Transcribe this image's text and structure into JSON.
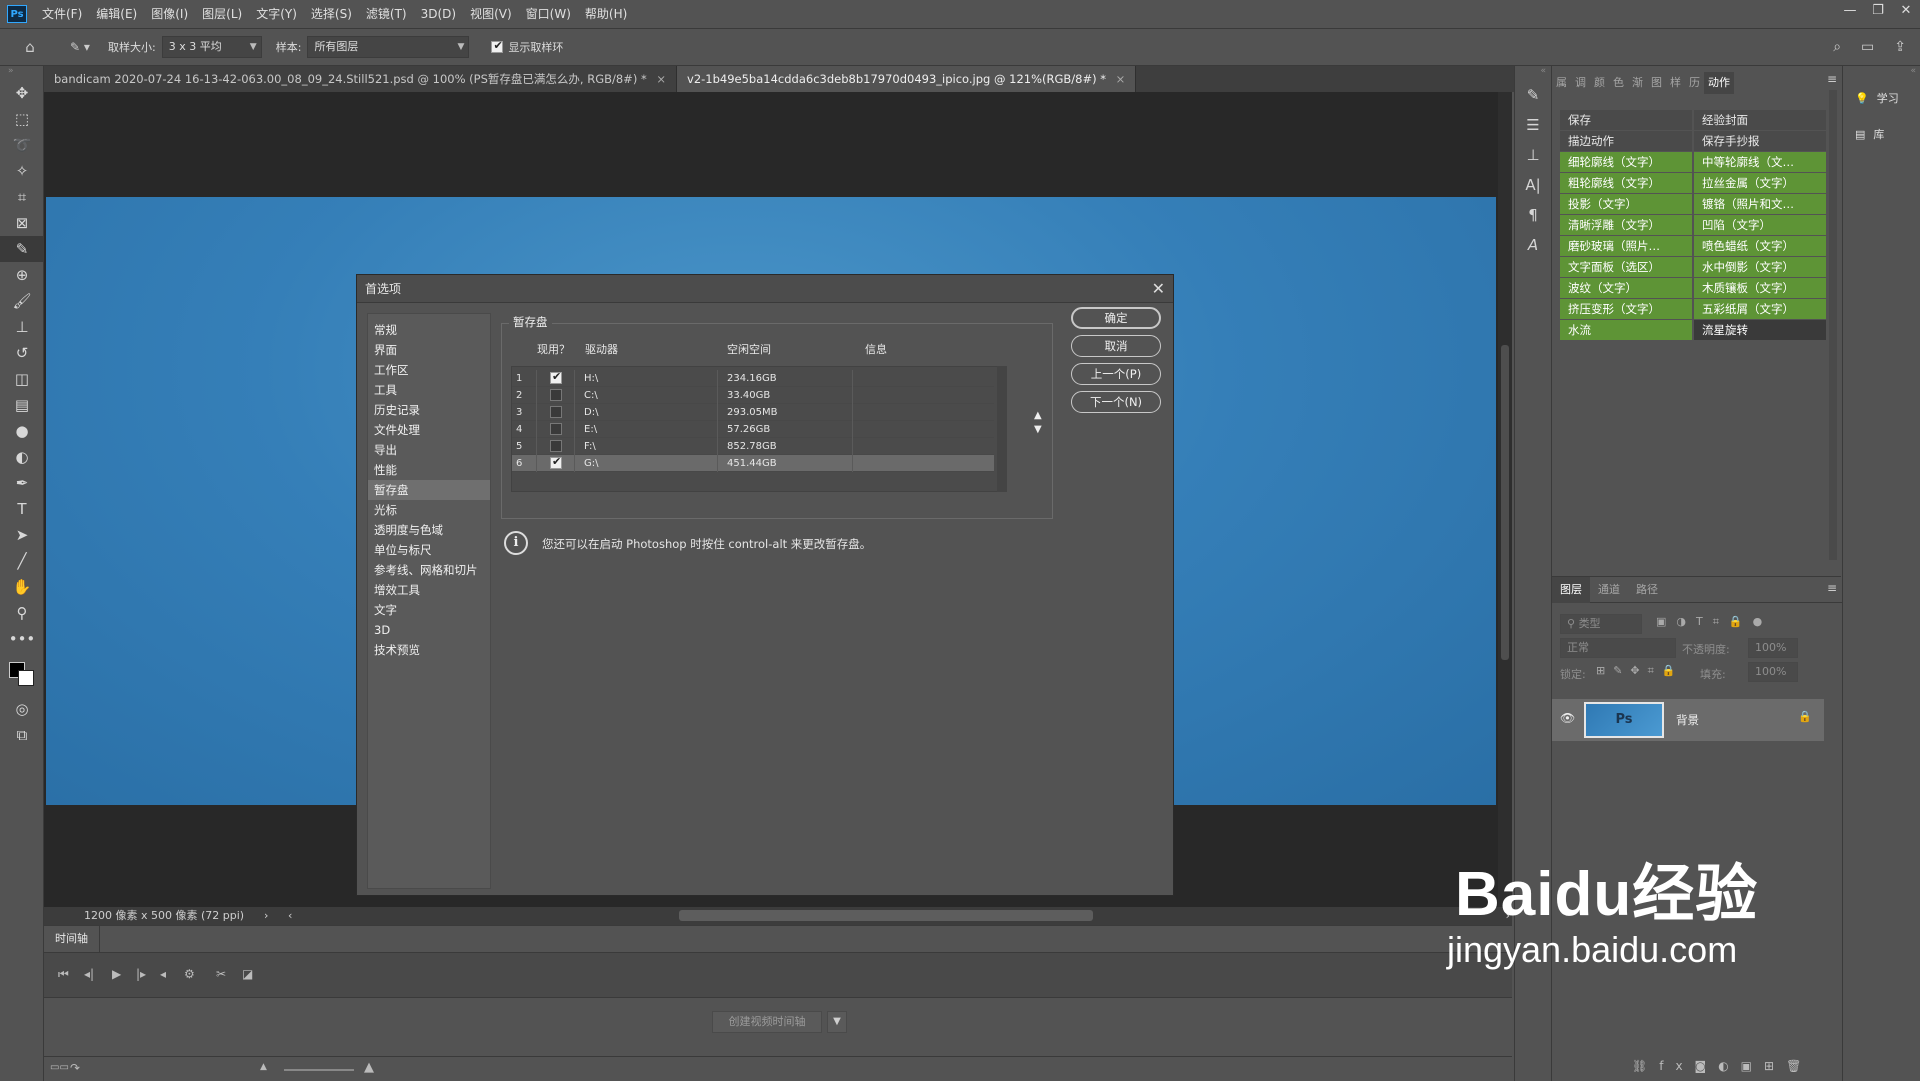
{
  "menubar": {
    "logo": "Ps",
    "items": [
      "文件(F)",
      "编辑(E)",
      "图像(I)",
      "图层(L)",
      "文字(Y)",
      "选择(S)",
      "滤镜(T)",
      "3D(D)",
      "视图(V)",
      "窗口(W)",
      "帮助(H)"
    ]
  },
  "optbar": {
    "sample_size_label": "取样大小:",
    "sample_size_value": "3 x 3 平均",
    "sample_label": "样本:",
    "sample_value": "所有图层",
    "show_ring_label": "显示取样环"
  },
  "tabs": [
    {
      "label": "bandicam 2020-07-24 16-13-42-063.00_08_09_24.Still521.psd @ 100% (PS暂存盘已满怎么办, RGB/8#) *",
      "active": false
    },
    {
      "label": "v2-1b49e5ba14cdda6c3deb8b17970d0493_ipico.jpg @ 121%(RGB/8#) *",
      "active": true
    }
  ],
  "status": {
    "doc_size": "1200 像素 x 500 像素 (72 ppi)"
  },
  "timeline": {
    "tab_label": "时间轴",
    "create_button": "创建视频时间轴"
  },
  "actions_panel": {
    "tabs": [
      "属",
      "调",
      "颜",
      "色",
      "渐",
      "图",
      "样",
      "历",
      "动作"
    ],
    "actions": [
      {
        "label": "保存",
        "style": "plain"
      },
      {
        "label": "经验封面",
        "style": "plain"
      },
      {
        "label": "描边动作",
        "style": "plain"
      },
      {
        "label": "保存手抄报",
        "style": "plain"
      },
      {
        "label": "细轮廓线（文字）",
        "style": "green"
      },
      {
        "label": "中等轮廓线（文…",
        "style": "green"
      },
      {
        "label": "粗轮廓线（文字）",
        "style": "green"
      },
      {
        "label": "拉丝金属（文字）",
        "style": "green"
      },
      {
        "label": "投影（文字）",
        "style": "green"
      },
      {
        "label": "镀铬（照片和文…",
        "style": "green"
      },
      {
        "label": "清晰浮雕（文字）",
        "style": "green"
      },
      {
        "label": "凹陷（文字）",
        "style": "green"
      },
      {
        "label": "磨砂玻璃（照片…",
        "style": "green"
      },
      {
        "label": "喷色蜡纸（文字）",
        "style": "green"
      },
      {
        "label": "文字面板（选区）",
        "style": "green"
      },
      {
        "label": "水中倒影（文字）",
        "style": "green"
      },
      {
        "label": "波纹（文字）",
        "style": "green"
      },
      {
        "label": "木质镶板（文字）",
        "style": "green"
      },
      {
        "label": "挤压变形（文字）",
        "style": "green"
      },
      {
        "label": "五彩纸屑（文字）",
        "style": "green"
      },
      {
        "label": "水流",
        "style": "green"
      },
      {
        "label": "流星旋转",
        "style": "dark"
      }
    ]
  },
  "layers_panel": {
    "tabs": [
      "图层",
      "通道",
      "路径"
    ],
    "filter_placeholder": "类型",
    "blend_mode": "正常",
    "opacity_label": "不透明度:",
    "opacity_value": "100%",
    "lock_label": "锁定:",
    "fill_label": "填充:",
    "fill_value": "100%",
    "layer_name": "背景",
    "thumb_text": "Ps"
  },
  "right_column": {
    "learn": "学习",
    "library": "库"
  },
  "dialog": {
    "title": "首选项",
    "categories": [
      "常规",
      "界面",
      "工作区",
      "工具",
      "历史记录",
      "文件处理",
      "导出",
      "性能",
      "暂存盘",
      "光标",
      "透明度与色域",
      "单位与标尺",
      "参考线、网格和切片",
      "增效工具",
      "文字",
      "3D",
      "技术预览"
    ],
    "selected_category": "暂存盘",
    "group_label": "暂存盘",
    "columns": [
      "现用？",
      "驱动器",
      "空闲空间",
      "信息"
    ],
    "drives": [
      {
        "num": "1",
        "active": true,
        "drive": "H:\\",
        "free": "234.16GB",
        "info": ""
      },
      {
        "num": "2",
        "active": false,
        "drive": "C:\\",
        "free": "33.40GB",
        "info": ""
      },
      {
        "num": "3",
        "active": false,
        "drive": "D:\\",
        "free": "293.05MB",
        "info": ""
      },
      {
        "num": "4",
        "active": false,
        "drive": "E:\\",
        "free": "57.26GB",
        "info": ""
      },
      {
        "num": "5",
        "active": false,
        "drive": "F:\\",
        "free": "852.78GB",
        "info": ""
      },
      {
        "num": "6",
        "active": true,
        "drive": "G:\\",
        "free": "451.44GB",
        "info": ""
      }
    ],
    "tip": "您还可以在启动 Photoshop 时按住 control-alt 来更改暂存盘。",
    "buttons": {
      "ok": "确定",
      "cancel": "取消",
      "prev": "上一个(P)",
      "next": "下一个(N)"
    }
  },
  "watermark": {
    "brand": "Baidu经验",
    "url": "jingyan.baidu.com"
  }
}
